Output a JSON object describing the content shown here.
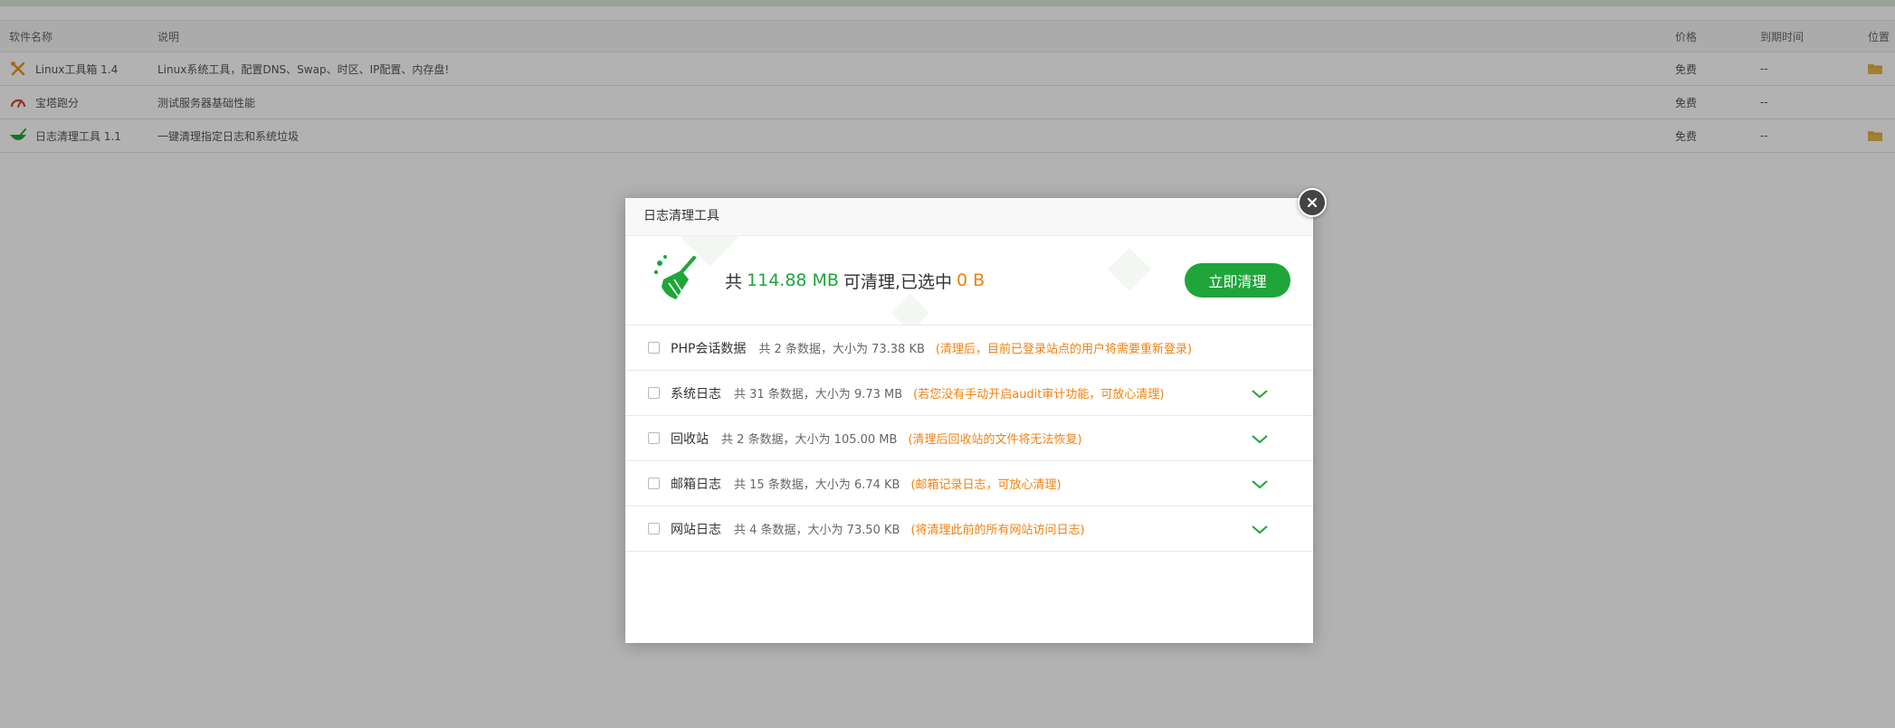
{
  "table": {
    "headers": {
      "name": "软件名称",
      "desc": "说明",
      "price": "价格",
      "expire": "到期时间",
      "position": "位置"
    },
    "rows": [
      {
        "icon": "tools-icon",
        "name": "Linux工具箱 1.4",
        "desc": "Linux系统工具，配置DNS、Swap、时区、IP配置、内存盘!",
        "price": "免费",
        "expire": "--",
        "has_folder": true
      },
      {
        "icon": "speedometer-icon",
        "name": "宝塔跑分",
        "desc": "测试服务器基础性能",
        "price": "免费",
        "expire": "--",
        "has_folder": false
      },
      {
        "icon": "broom-icon",
        "name": "日志清理工具 1.1",
        "desc": "一键清理指定日志和系统垃圾",
        "price": "免费",
        "expire": "--",
        "has_folder": true
      }
    ]
  },
  "modal": {
    "title": "日志清理工具",
    "summary": {
      "prefix": "共",
      "total": "114.88 MB",
      "middle": "可清理,已选中",
      "selected": "0 B"
    },
    "clean_button": "立即清理",
    "items": [
      {
        "name": "PHP会话数据",
        "info": "共 2 条数据，大小为 73.38 KB",
        "tip": "(清理后，目前已登录站点的用户将需要重新登录)",
        "expandable": false
      },
      {
        "name": "系统日志",
        "info": "共 31 条数据，大小为 9.73 MB",
        "tip": "(若您没有手动开启audit审计功能，可放心清理)",
        "expandable": true
      },
      {
        "name": "回收站",
        "info": "共 2 条数据，大小为 105.00 MB",
        "tip": "(清理后回收站的文件将无法恢复)",
        "expandable": true
      },
      {
        "name": "邮箱日志",
        "info": "共 15 条数据，大小为 6.74 KB",
        "tip": "(邮箱记录日志，可放心清理)",
        "expandable": true
      },
      {
        "name": "网站日志",
        "info": "共 4 条数据，大小为 73.50 KB",
        "tip": "(将清理此前的所有网站访问日志)",
        "expandable": true
      }
    ]
  },
  "colors": {
    "accent": "#20a53a",
    "warning": "#f0810f",
    "overlay": "rgba(0,0,0,0.30)"
  }
}
